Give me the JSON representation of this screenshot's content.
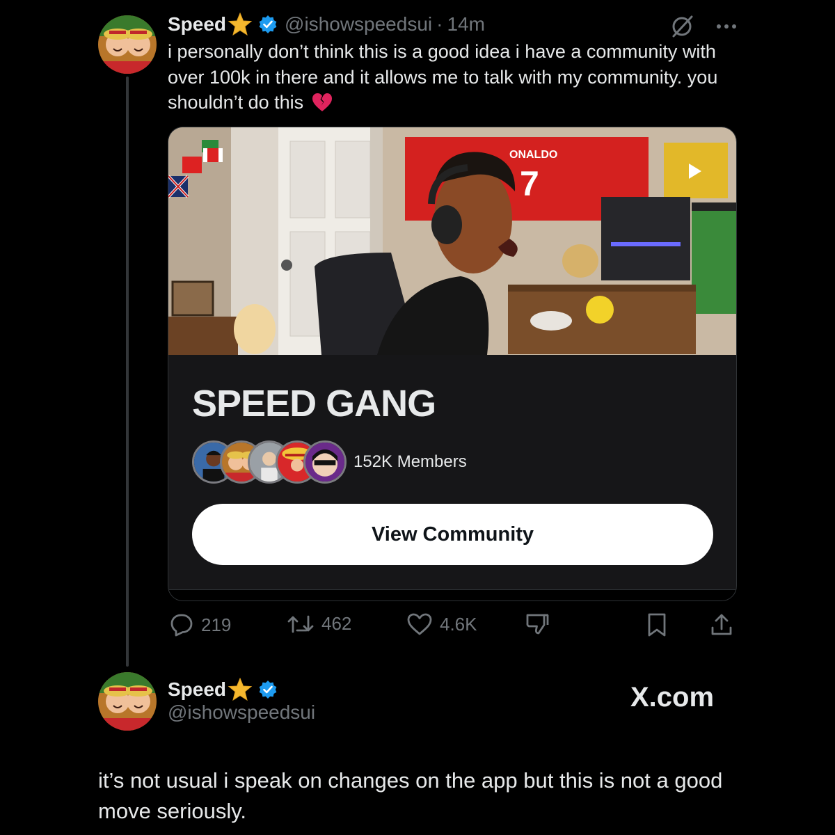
{
  "tweet": {
    "author": {
      "display_name": "Speed",
      "handle": "@ishowspeedsui",
      "time": "14m",
      "separator": "·"
    },
    "text": "i personally don’t think this is a good idea i have a community with over 100k in there and it allows me to talk with my community. you shouldn’t do this",
    "emoji": "broken-heart-icon",
    "card": {
      "banner_jersey_text": "ONALDO",
      "banner_jersey_number": "7",
      "title": "SPEED GANG",
      "members": "152K Members",
      "button": "View Community"
    },
    "actions": {
      "replies": "219",
      "reposts": "462",
      "likes": "4.6K"
    }
  },
  "quote": {
    "author": {
      "display_name": "Speed",
      "handle": "@ishowspeedsui"
    },
    "brand": "X.com",
    "text": "it’s not usual i speak on changes on the app but this is not a good move seriously."
  },
  "colors": {
    "background": "#000000",
    "text": "#e7e9ea",
    "muted": "#71767b",
    "verified": "#1d9bf0",
    "star": "#f5b82e",
    "heart_broken": "#e0245e"
  }
}
